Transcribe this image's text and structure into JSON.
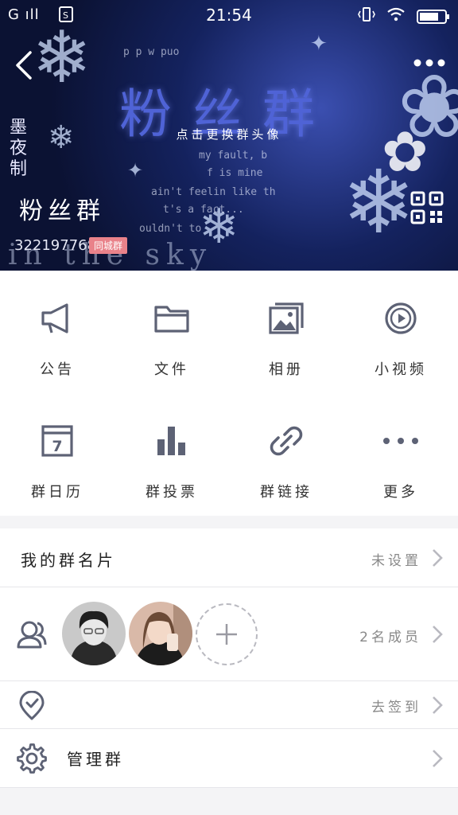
{
  "status_bar": {
    "signal": "G",
    "time": "21:54",
    "battery_level": 0.75
  },
  "header": {
    "banner_title": "粉丝群",
    "change_avatar_hint": "点击更换群头像",
    "vertical_text": "墨夜制",
    "sky_text": "in the sky",
    "background_words": [
      "p p w puo",
      "my fault, b",
      "f is mine",
      "ain't feelin like th",
      "t's a fact...",
      "ouldn't to"
    ],
    "group_name": "粉丝群",
    "group_number": "322197768",
    "city_tag": "同城群",
    "accent_color": "#4f63d6"
  },
  "features": [
    {
      "label": "公告",
      "icon": "megaphone-icon"
    },
    {
      "label": "文件",
      "icon": "folder-icon"
    },
    {
      "label": "相册",
      "icon": "photo-album-icon"
    },
    {
      "label": "小视频",
      "icon": "video-play-icon"
    },
    {
      "label": "群日历",
      "icon": "calendar-icon"
    },
    {
      "label": "群投票",
      "icon": "bar-chart-icon"
    },
    {
      "label": "群链接",
      "icon": "link-icon"
    },
    {
      "label": "更多",
      "icon": "more-dots-icon"
    }
  ],
  "calendar_day": "7",
  "my_card": {
    "title": "我的群名片",
    "value": "未设置"
  },
  "members": {
    "count_text": "2名成员"
  },
  "checkin": {
    "value": "去签到"
  },
  "manage": {
    "title": "管理群"
  },
  "colors": {
    "icon": "#5d6275",
    "tag": "#e9828a",
    "text_gray": "#888888"
  }
}
